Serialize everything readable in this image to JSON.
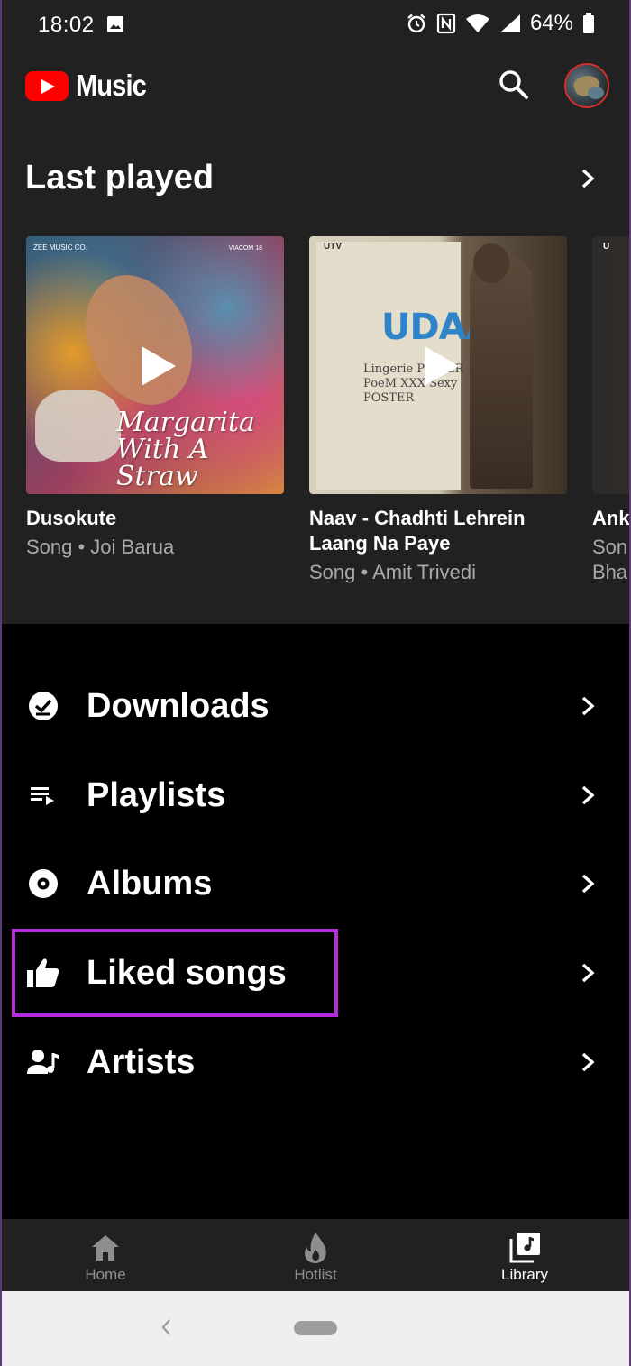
{
  "status_bar": {
    "time": "18:02",
    "battery": "64%",
    "icons": [
      "image-icon",
      "alarm-icon",
      "nfc-icon",
      "wifi-icon",
      "signal-icon",
      "battery-icon"
    ]
  },
  "app_bar": {
    "logo_text": "Music",
    "brand_color": "#ff0000",
    "search_icon": "search-icon",
    "avatar_icon": "avatar"
  },
  "last_played": {
    "title": "Last played",
    "cards": [
      {
        "title": "Dusokute",
        "subtitle": "Song • Joi Barua",
        "art_text": "Margarita With A Straw",
        "art_tag": "ZEE MUSIC CO.",
        "art_tag2": "VIACOM 18"
      },
      {
        "title": "Naav - Chadhti Lehrein Laang Na Paye",
        "subtitle": "Song • Amit Trivedi",
        "art_text": "UDAAN",
        "art_words": "Lingerie POWER PoeM XXX Sexy POSTER",
        "art_tag": "UTV"
      },
      {
        "title": "Ank",
        "subtitle": "Son",
        "subtitle2": "Bha",
        "art_tag": "U"
      }
    ]
  },
  "library": {
    "items": [
      {
        "label": "Downloads",
        "icon": "download-check-icon"
      },
      {
        "label": "Playlists",
        "icon": "playlist-icon"
      },
      {
        "label": "Albums",
        "icon": "album-icon"
      },
      {
        "label": "Liked songs",
        "icon": "thumbs-up-icon",
        "highlighted": true
      },
      {
        "label": "Artists",
        "icon": "artist-icon"
      }
    ],
    "highlight_color": "#b62be0"
  },
  "bottom_nav": {
    "items": [
      {
        "label": "Home",
        "icon": "home-icon",
        "active": false
      },
      {
        "label": "Hotlist",
        "icon": "flame-icon",
        "active": false
      },
      {
        "label": "Library",
        "icon": "library-icon",
        "active": true
      }
    ]
  }
}
